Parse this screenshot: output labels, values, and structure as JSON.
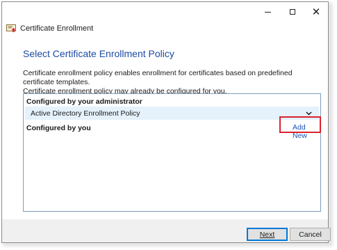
{
  "window": {
    "title": "Certificate Enrollment",
    "controls": {
      "minimize_icon": "minimize-icon",
      "maximize_icon": "maximize-icon",
      "close_icon": "close-icon",
      "close_glyph": "✕"
    }
  },
  "page": {
    "heading": "Select Certificate Enrollment Policy",
    "description_line1": "Certificate enrollment policy enables enrollment for certificates based on predefined certificate templates.",
    "description_line2": "Certificate enrollment policy may already be configured for you."
  },
  "policies": {
    "admin_section_label": "Configured by your administrator",
    "admin_policy_name": "Active Directory Enrollment Policy",
    "user_section_label": "Configured by you",
    "add_new_label": "Add New"
  },
  "footer": {
    "next_label": "Next",
    "cancel_label": "Cancel"
  },
  "colors": {
    "heading": "#1c4aa5",
    "link": "#1c55b8",
    "highlight": "#d9232e",
    "selected_row": "#e5f1fb"
  }
}
